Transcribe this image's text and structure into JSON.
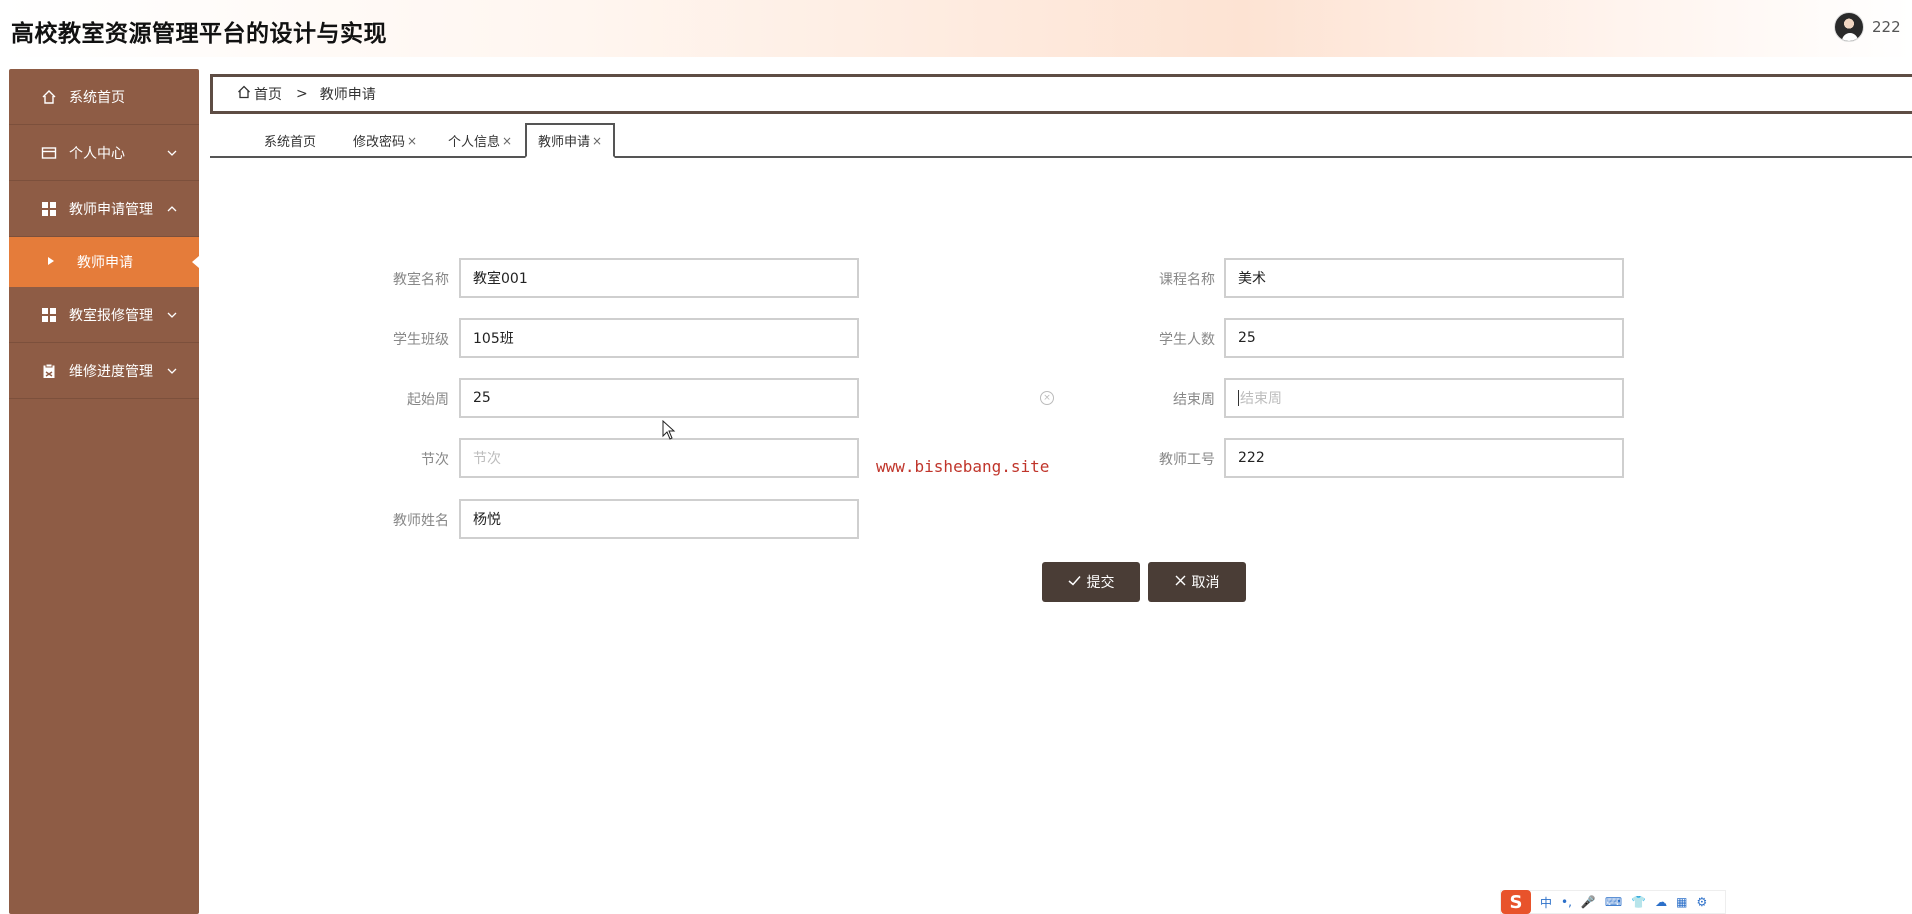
{
  "header": {
    "title": "高校教室资源管理平台的设计与实现",
    "username": "222"
  },
  "sidebar": {
    "items": [
      {
        "label": "系统首页",
        "icon": "home-icon"
      },
      {
        "label": "个人中心",
        "icon": "card-icon",
        "arrow": "chevron-down-icon"
      },
      {
        "label": "教师申请管理",
        "icon": "grid-icon",
        "arrow": "chevron-up-icon"
      },
      {
        "label": "教室报修管理",
        "icon": "grid-icon",
        "arrow": "chevron-down-icon"
      },
      {
        "label": "维修进度管理",
        "icon": "clipboard-icon",
        "arrow": "chevron-down-icon"
      }
    ],
    "submenu": {
      "label": "教师申请",
      "icon": "caret-right-icon"
    }
  },
  "breadcrumb": {
    "home": "首页",
    "separator": ">",
    "current": "教师申请"
  },
  "tabs": [
    {
      "label": "系统首页",
      "closable": false
    },
    {
      "label": "修改密码",
      "closable": true
    },
    {
      "label": "个人信息",
      "closable": true
    },
    {
      "label": "教师申请",
      "closable": true,
      "active": true
    }
  ],
  "tab_close_glyph": "×",
  "form": {
    "classroom_name": {
      "label": "教室名称",
      "value": "教室001"
    },
    "course_name": {
      "label": "课程名称",
      "value": "美术"
    },
    "student_class": {
      "label": "学生班级",
      "value": "105班"
    },
    "student_count": {
      "label": "学生人数",
      "value": "25"
    },
    "start_week": {
      "label": "起始周",
      "value": "25"
    },
    "end_week": {
      "label": "结束周",
      "value": "",
      "placeholder": "结束周"
    },
    "period": {
      "label": "节次",
      "value": "",
      "placeholder": "节次"
    },
    "teacher_id": {
      "label": "教师工号",
      "value": "222"
    },
    "teacher_name": {
      "label": "教师姓名",
      "value": "杨悦"
    }
  },
  "buttons": {
    "submit": {
      "label": "提交",
      "icon": "check-icon"
    },
    "cancel": {
      "label": "取消",
      "icon": "close-icon"
    }
  },
  "watermark": "www.bishebang.site",
  "ime": {
    "logo": "S",
    "items": [
      "中",
      "•,",
      "🎤",
      "⌨",
      "👕",
      "☁",
      "▦",
      "⚙"
    ]
  },
  "colors": {
    "sidebar_bg": "#8e5c45",
    "submenu_active": "#e57c3a",
    "button_bg": "#4a3d36",
    "watermark": "#c0352b"
  }
}
